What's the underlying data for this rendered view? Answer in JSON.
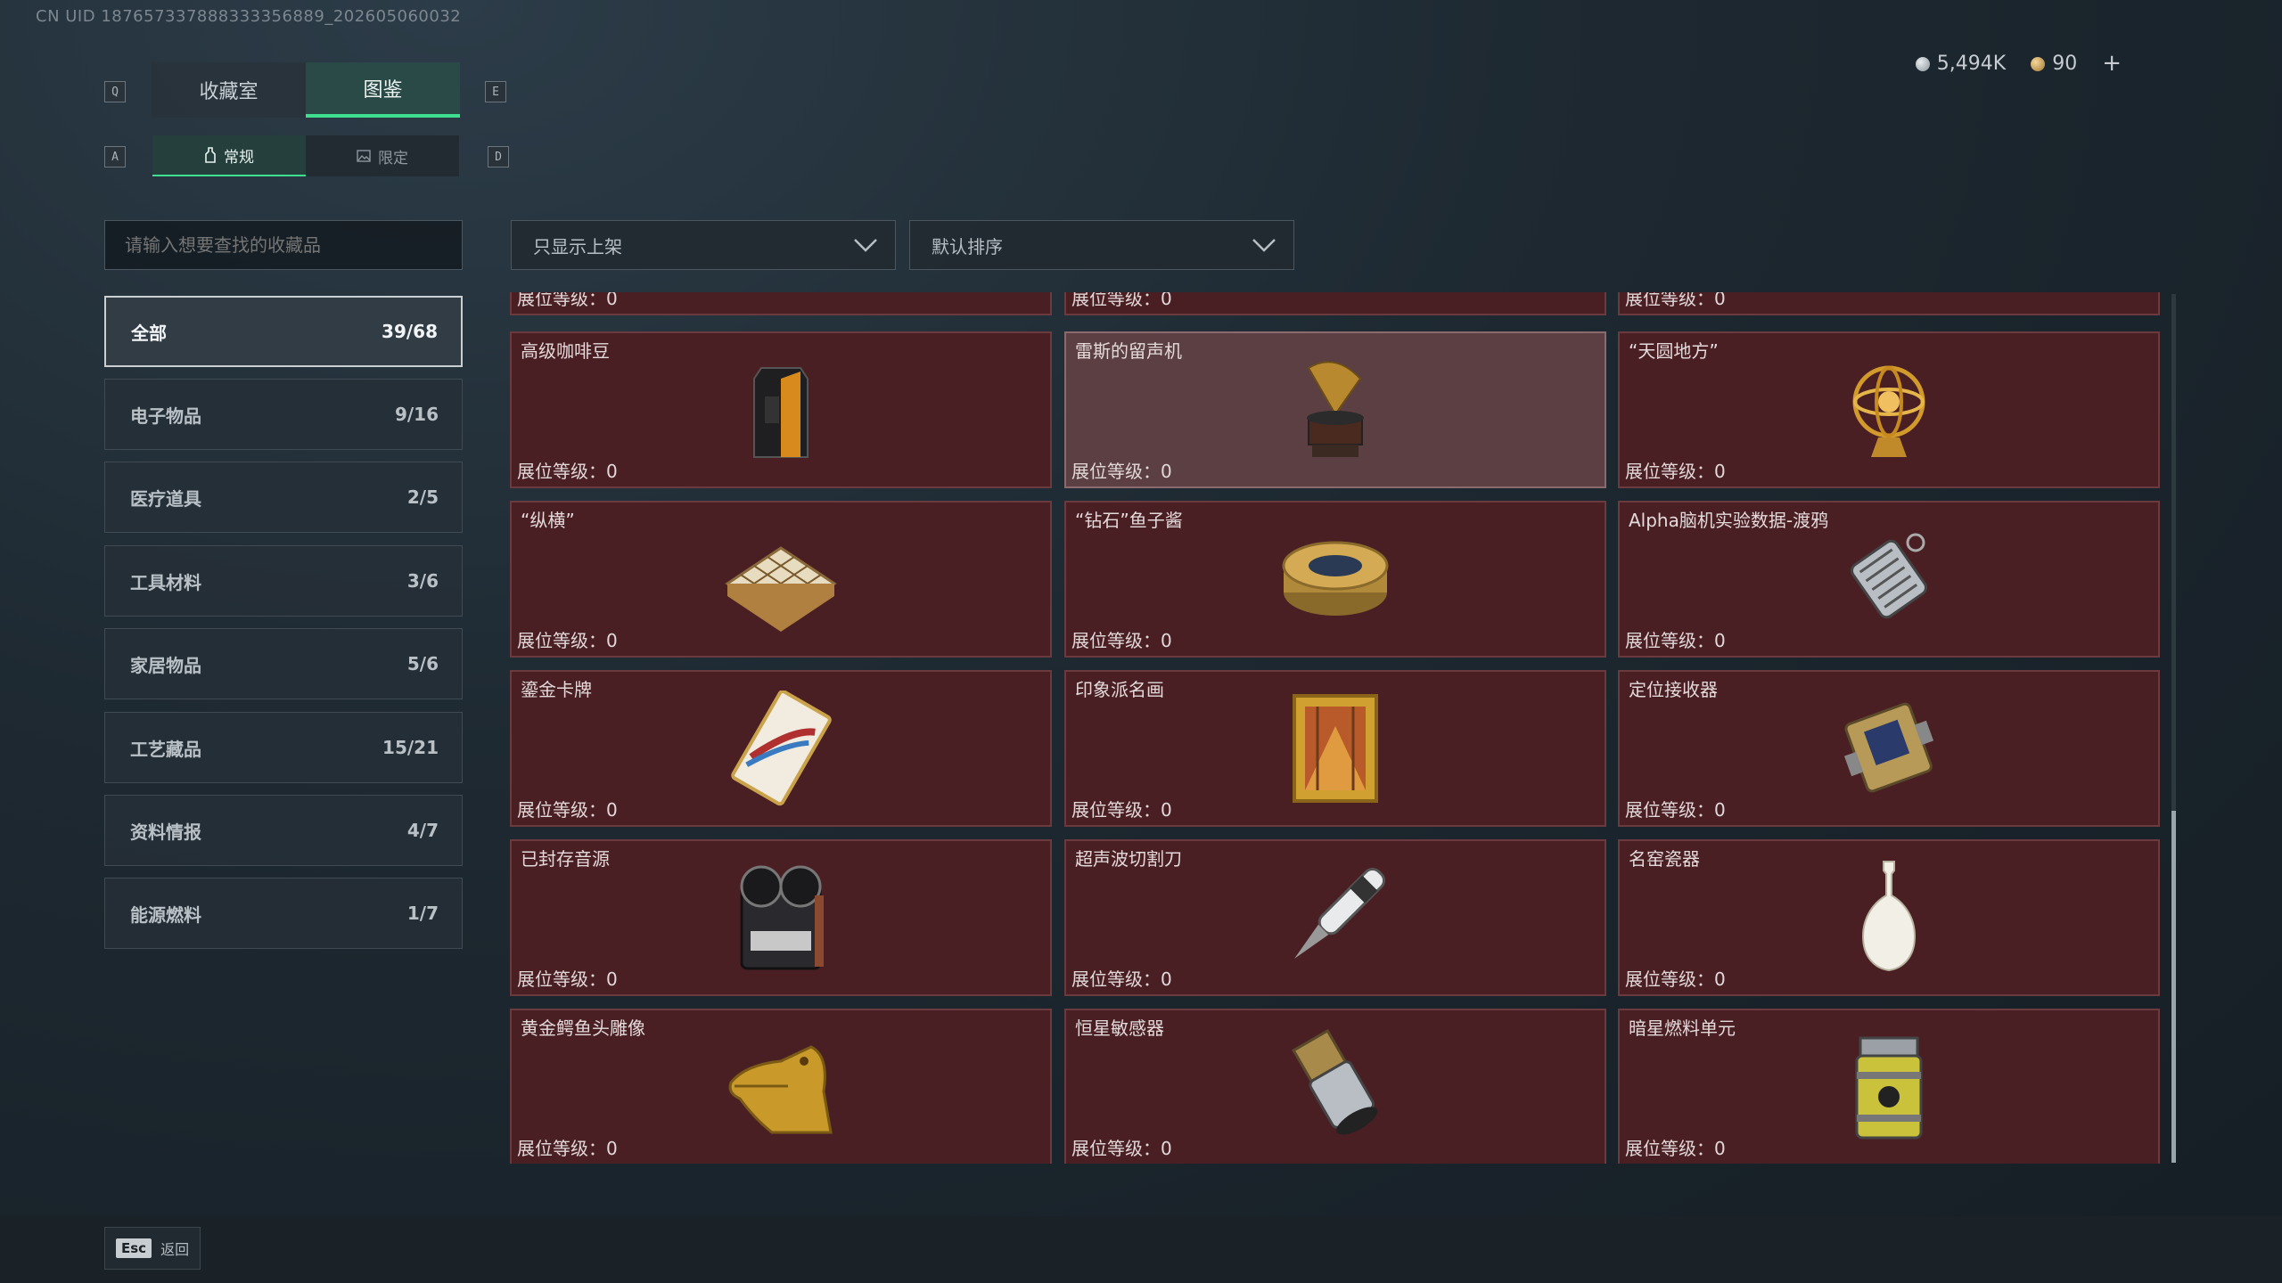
{
  "uid": "CN UID 187657337888333356889_202605060032",
  "hotkeys": {
    "prev_tab": "Q",
    "next_tab": "E",
    "prev_sub": "A",
    "next_sub": "D"
  },
  "tabs": [
    {
      "label": "收藏室"
    },
    {
      "label": "图鉴"
    }
  ],
  "subtabs": [
    {
      "label": "常规"
    },
    {
      "label": "限定"
    }
  ],
  "currency": {
    "primary": "5,494K",
    "secondary": "90",
    "add": "+"
  },
  "search": {
    "placeholder": "请输入想要查找的收藏品"
  },
  "filters": {
    "display": "只显示上架",
    "sort": "默认排序"
  },
  "categories": [
    {
      "label": "全部",
      "count": "39/68"
    },
    {
      "label": "电子物品",
      "count": "9/16"
    },
    {
      "label": "医疗道具",
      "count": "2/5"
    },
    {
      "label": "工具材料",
      "count": "3/6"
    },
    {
      "label": "家居物品",
      "count": "5/6"
    },
    {
      "label": "工艺藏品",
      "count": "15/21"
    },
    {
      "label": "资料情报",
      "count": "4/7"
    },
    {
      "label": "能源燃料",
      "count": "1/7"
    }
  ],
  "level_prefix": "展位等级：",
  "items": [
    {
      "name": "",
      "level": "展位等级：0",
      "icon": "partial-item-icon"
    },
    {
      "name": "",
      "level": "展位等级：0",
      "icon": "partial-item-icon"
    },
    {
      "name": "",
      "level": "展位等级：0",
      "icon": "partial-item-icon"
    },
    {
      "name": "高级咖啡豆",
      "level": "展位等级：0",
      "icon": "coffee-bag-icon"
    },
    {
      "name": "雷斯的留声机",
      "level": "展位等级：0",
      "icon": "gramophone-icon"
    },
    {
      "name": "“天圆地方”",
      "level": "展位等级：0",
      "icon": "armillary-sphere-icon"
    },
    {
      "name": "“纵横”",
      "level": "展位等级：0",
      "icon": "chess-board-icon"
    },
    {
      "name": "“钻石”鱼子酱",
      "level": "展位等级：0",
      "icon": "caviar-tin-icon"
    },
    {
      "name": "Alpha脑机实验数据-渡鸦",
      "level": "展位等级：0",
      "icon": "data-drive-icon"
    },
    {
      "name": "鎏金卡牌",
      "level": "展位等级：0",
      "icon": "gilded-card-icon"
    },
    {
      "name": "印象派名画",
      "level": "展位等级：0",
      "icon": "framed-painting-icon"
    },
    {
      "name": "定位接收器",
      "level": "展位等级：0",
      "icon": "receiver-device-icon"
    },
    {
      "name": "已封存音源",
      "level": "展位等级：0",
      "icon": "tape-recorder-icon"
    },
    {
      "name": "超声波切割刀",
      "level": "展位等级：0",
      "icon": "ultrasonic-knife-icon"
    },
    {
      "name": "名窑瓷器",
      "level": "展位等级：0",
      "icon": "porcelain-vase-icon"
    },
    {
      "name": "黄金鳄鱼头雕像",
      "level": "展位等级：0",
      "icon": "gold-crocodile-icon"
    },
    {
      "name": "恒星敏感器",
      "level": "展位等级：0",
      "icon": "star-sensor-icon"
    },
    {
      "name": "暗星燃料单元",
      "level": "展位等级：0",
      "icon": "fuel-canister-icon"
    }
  ],
  "footer": {
    "esc_key": "Esc",
    "back_label": "返回"
  },
  "colors": {
    "accent": "#3ee08f",
    "card_bg": "#4a1f24",
    "card_highlight": "#5b3f43"
  }
}
